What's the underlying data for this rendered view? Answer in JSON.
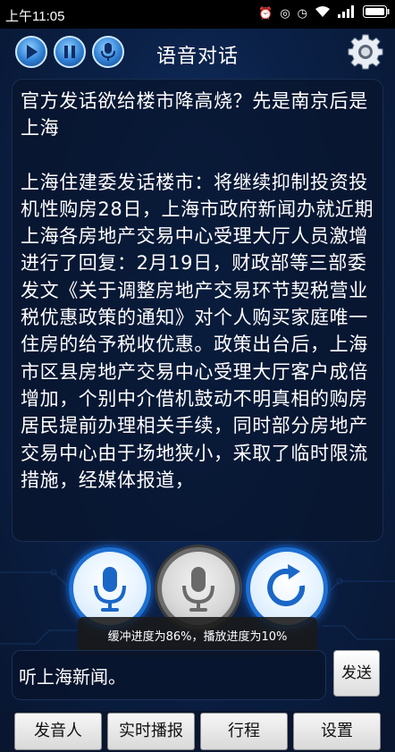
{
  "status": {
    "time": "上午11:05",
    "icons": [
      "alarm-icon",
      "headset-icon",
      "clock-icon",
      "wifi-icon",
      "signal-icon",
      "battery-icon"
    ]
  },
  "header": {
    "title": "语音对话",
    "buttons": [
      "play-icon",
      "pause-icon",
      "mic-icon"
    ],
    "settings_icon": "gear-icon"
  },
  "article": {
    "headline": "官方发话欲给楼市降高烧？先是南京后是上海",
    "body": "上海住建委发话楼市：将继续抑制投资投机性购房28日，上海市政府新闻办就近期上海各房地产交易中心受理大厅人员激增进行了回复：2月19日，财政部等三部委发文《关于调整房地产交易环节契税营业税优惠政策的通知》对个人购买家庭唯一住房的给予税收优惠。政策出台后，上海市区县房地产交易中心受理大厅客户成倍增加，个别中介借机鼓动不明真相的购房居民提前办理相关手续，同时部分房地产交易中心由于场地狭小，采取了临时限流措施，经媒体报道，"
  },
  "controls": {
    "mic_buttons": [
      "mic-icon",
      "mic-icon",
      "refresh-icon"
    ],
    "toast": "缓冲进度为86%，播放进度为10%"
  },
  "input": {
    "value": "听上海新闻。",
    "send_label": "发送"
  },
  "tabs": [
    "发音人",
    "实时播报",
    "行程",
    "设置"
  ],
  "colors": {
    "accent_blue": "#1e6fd0",
    "background": "#0b2148",
    "panel": "#08142d"
  }
}
